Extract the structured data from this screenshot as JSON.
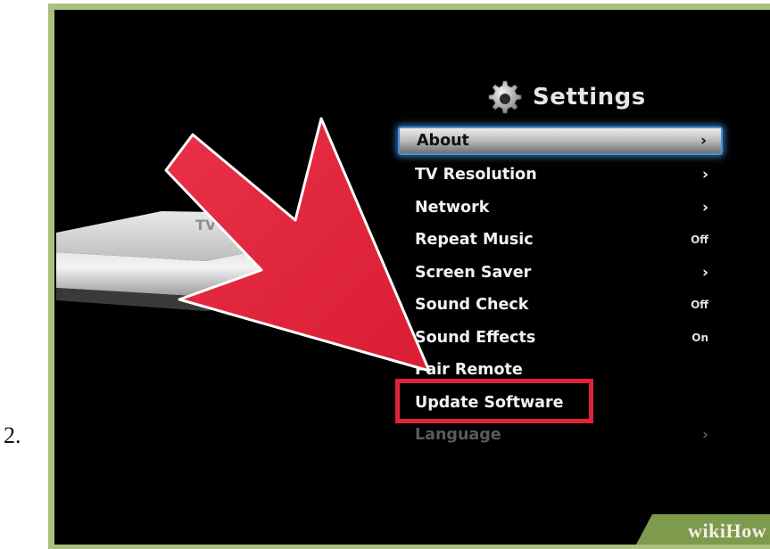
{
  "step": {
    "number": "2."
  },
  "header": {
    "title": "Settings",
    "icon": "gear-icon"
  },
  "menu": {
    "items": [
      {
        "label": "About",
        "value": "›",
        "state": "selected"
      },
      {
        "label": "TV Resolution",
        "value": "›"
      },
      {
        "label": "Network",
        "value": "›"
      },
      {
        "label": "Repeat Music",
        "value": "Off"
      },
      {
        "label": "Screen Saver",
        "value": "›"
      },
      {
        "label": "Sound Check",
        "value": "Off"
      },
      {
        "label": "Sound Effects",
        "value": "On"
      },
      {
        "label": "Pair Remote",
        "value": ""
      },
      {
        "label": "Update Software",
        "value": "",
        "state": "highlighted"
      },
      {
        "label": "Language",
        "value": "›",
        "state": "dim"
      }
    ]
  },
  "colors": {
    "frame": "#a9c07f",
    "screen": "#000000",
    "arrow": "#e0233a",
    "selection_glow": "#4a90d8"
  },
  "watermark": {
    "text": "wikiHow"
  }
}
